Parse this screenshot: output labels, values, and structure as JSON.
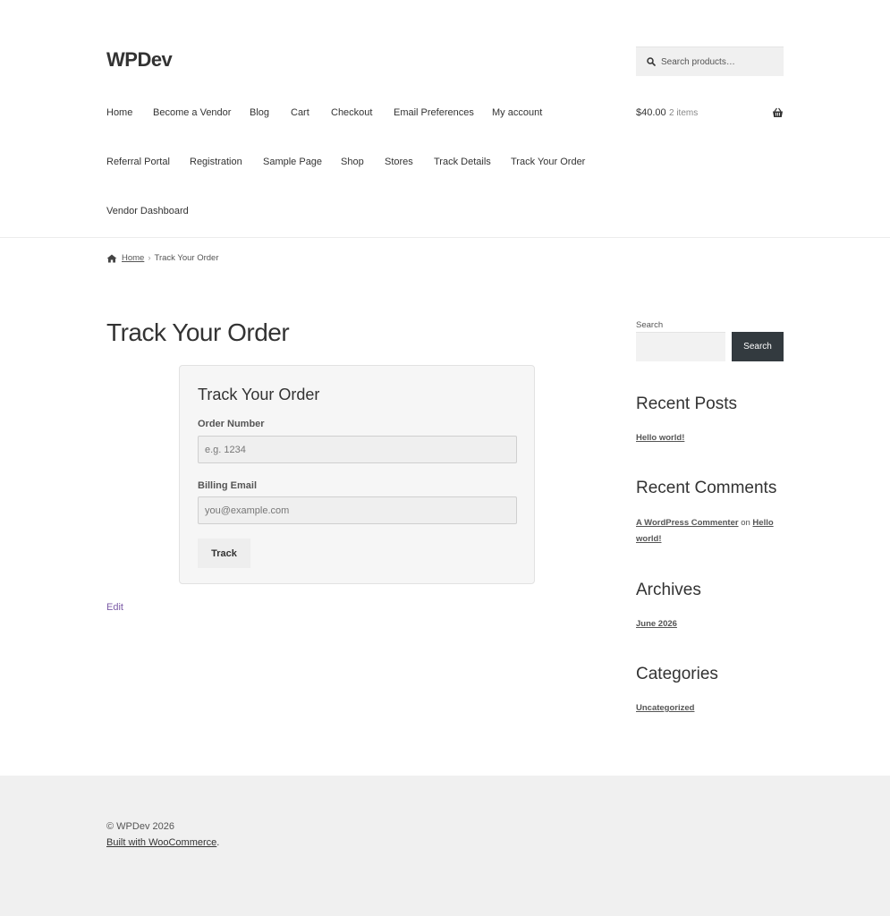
{
  "site": {
    "title": "WPDev"
  },
  "header_search": {
    "placeholder": "Search products…"
  },
  "nav": {
    "items": [
      "Home",
      "Become a Vendor",
      "Blog",
      "Cart",
      "Checkout",
      "Email Preferences",
      "My account",
      "Referral Portal",
      "Registration",
      "Sample Page",
      "Shop",
      "Stores",
      "Track Details",
      "Track Your Order",
      "Vendor Dashboard"
    ]
  },
  "cart": {
    "amount": "$40.00",
    "count": "2 items"
  },
  "breadcrumb": {
    "home": "Home",
    "separator": "›",
    "current": "Track Your Order"
  },
  "page": {
    "title": "Track Your Order",
    "edit": "Edit"
  },
  "track_form": {
    "title": "Track Your Order",
    "order_label": "Order Number",
    "order_placeholder": "e.g. 1234",
    "email_label": "Billing Email",
    "email_placeholder": "you@example.com",
    "button": "Track"
  },
  "sidebar": {
    "search_label": "Search",
    "search_button": "Search",
    "recent_posts": {
      "title": "Recent Posts",
      "items": [
        "Hello world!"
      ]
    },
    "recent_comments": {
      "title": "Recent Comments",
      "author": "A WordPress Commenter",
      "on": "on",
      "post_line1": "Hello",
      "post_line2": "world!"
    },
    "archives": {
      "title": "Archives",
      "items": [
        "June 2026"
      ]
    },
    "categories": {
      "title": "Categories",
      "items": [
        "Uncategorized"
      ]
    }
  },
  "footer": {
    "copyright": "© WPDev 2026",
    "built_with": "Built with WooCommerce",
    "period": "."
  },
  "colors": {
    "accent": "#7b5aa6",
    "button_dark": "#333a3f",
    "footer_bg": "#f0f0f0"
  },
  "icons": {
    "search": "search-icon",
    "basket": "basket-icon",
    "home": "home-icon"
  }
}
